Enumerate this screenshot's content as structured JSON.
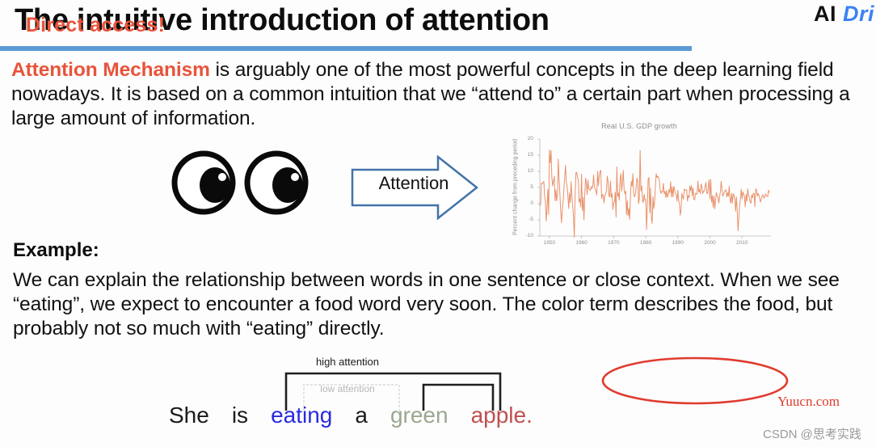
{
  "slide": {
    "title": "The intuitive introduction of attention",
    "logo_prefix": "AI ",
    "logo_accent": "Dri",
    "accent_color": "#5b9bd5",
    "highlight_color": "#e8533a"
  },
  "intro": {
    "highlight": "Attention Mechanism",
    "rest": " is arguably one of the most powerful concepts in the deep learning field nowadays. It is based on a common intuition that we “attend to” a certain part when processing a large amount of information."
  },
  "example": {
    "label": "Example:",
    "text": "We can explain the relationship between words in one sentence or close context. When we see “eating”, we expect to encounter a food word very soon. The color term describes the food, but probably not so much with “eating” directly."
  },
  "arrow": {
    "label": "Attention"
  },
  "eyes": {
    "name": "pair-of-eyes-illustration"
  },
  "callout": {
    "text": "Direct access!",
    "color": "#e8533a"
  },
  "sentence_diagram": {
    "high_attention_label": "high attention",
    "low_attention_label": "low attention",
    "words": [
      {
        "text": "She",
        "color": "#1b1b1b"
      },
      {
        "text": "is",
        "color": "#1b1b1b"
      },
      {
        "text": "eating",
        "color": "#2a2ae0"
      },
      {
        "text": "a",
        "color": "#1b1b1b"
      },
      {
        "text": "green",
        "color": "#9aa890"
      },
      {
        "text": "apple.",
        "color": "#c05050"
      }
    ],
    "footnote": ""
  },
  "watermarks": {
    "yuucn": "Yuucn.com",
    "csdn": "CSDN @思考实践"
  },
  "chart_data": {
    "type": "line",
    "title": "Real U.S. GDP growth",
    "xlabel": "",
    "ylabel": "Percent change from preceding period",
    "xlim": [
      1947,
      2019
    ],
    "ylim": [
      -10,
      20
    ],
    "xticks": [
      1950,
      1960,
      1970,
      1980,
      1990,
      2000,
      2010
    ],
    "yticks": [
      -10,
      -5,
      0,
      5,
      10,
      15,
      20
    ],
    "grid": false,
    "legend": "none",
    "line_color": "#e8926b",
    "x": [
      1947,
      1947.25,
      1947.5,
      1947.75,
      1948,
      1948.25,
      1948.5,
      1948.75,
      1949,
      1949.25,
      1949.5,
      1949.75,
      1950,
      1950.25,
      1950.5,
      1950.75,
      1951,
      1951.25,
      1951.5,
      1951.75,
      1952,
      1952.25,
      1952.5,
      1952.75,
      1953,
      1953.25,
      1953.5,
      1953.75,
      1954,
      1954.25,
      1954.5,
      1954.75,
      1955,
      1955.25,
      1955.5,
      1955.75,
      1956,
      1956.25,
      1956.5,
      1956.75,
      1957,
      1957.25,
      1957.5,
      1957.75,
      1958,
      1958.25,
      1958.5,
      1958.75,
      1959,
      1959.25,
      1959.5,
      1959.75,
      1960,
      1960.25,
      1960.5,
      1960.75,
      1961,
      1961.25,
      1961.5,
      1961.75,
      1962,
      1962.25,
      1962.5,
      1962.75,
      1963,
      1963.25,
      1963.5,
      1963.75,
      1964,
      1964.25,
      1964.5,
      1964.75,
      1965,
      1965.25,
      1965.5,
      1965.75,
      1966,
      1966.25,
      1966.5,
      1966.75,
      1967,
      1967.25,
      1967.5,
      1967.75,
      1968,
      1968.25,
      1968.5,
      1968.75,
      1969,
      1969.25,
      1969.5,
      1969.75,
      1970,
      1970.25,
      1970.5,
      1970.75,
      1971,
      1971.25,
      1971.5,
      1971.75,
      1972,
      1972.25,
      1972.5,
      1972.75,
      1973,
      1973.25,
      1973.5,
      1973.75,
      1974,
      1974.25,
      1974.5,
      1974.75,
      1975,
      1975.25,
      1975.5,
      1975.75,
      1976,
      1976.25,
      1976.5,
      1976.75,
      1977,
      1977.25,
      1977.5,
      1977.75,
      1978,
      1978.25,
      1978.5,
      1978.75,
      1979,
      1979.25,
      1979.5,
      1979.75,
      1980,
      1980.25,
      1980.5,
      1980.75,
      1981,
      1981.25,
      1981.5,
      1981.75,
      1982,
      1982.25,
      1982.5,
      1982.75,
      1983,
      1983.25,
      1983.5,
      1983.75,
      1984,
      1984.25,
      1984.5,
      1984.75,
      1985,
      1985.25,
      1985.5,
      1985.75,
      1986,
      1986.25,
      1986.5,
      1986.75,
      1987,
      1987.25,
      1987.5,
      1987.75,
      1988,
      1988.25,
      1988.5,
      1988.75,
      1989,
      1989.25,
      1989.5,
      1989.75,
      1990,
      1990.25,
      1990.5,
      1990.75,
      1991,
      1991.25,
      1991.5,
      1991.75,
      1992,
      1992.25,
      1992.5,
      1992.75,
      1993,
      1993.25,
      1993.5,
      1993.75,
      1994,
      1994.25,
      1994.5,
      1994.75,
      1995,
      1995.25,
      1995.5,
      1995.75,
      1996,
      1996.25,
      1996.5,
      1996.75,
      1997,
      1997.25,
      1997.5,
      1997.75,
      1998,
      1998.25,
      1998.5,
      1998.75,
      1999,
      1999.25,
      1999.5,
      1999.75,
      2000,
      2000.25,
      2000.5,
      2000.75,
      2001,
      2001.25,
      2001.5,
      2001.75,
      2002,
      2002.25,
      2002.5,
      2002.75,
      2003,
      2003.25,
      2003.5,
      2003.75,
      2004,
      2004.25,
      2004.5,
      2004.75,
      2005,
      2005.25,
      2005.5,
      2005.75,
      2006,
      2006.25,
      2006.5,
      2006.75,
      2007,
      2007.25,
      2007.5,
      2007.75,
      2008,
      2008.25,
      2008.5,
      2008.75,
      2009,
      2009.25,
      2009.5,
      2009.75,
      2010,
      2010.25,
      2010.5,
      2010.75,
      2011,
      2011.25,
      2011.5,
      2011.75,
      2012,
      2012.25,
      2012.5,
      2012.75,
      2013,
      2013.25,
      2013.5,
      2013.75,
      2014,
      2014.25,
      2014.5,
      2014.75,
      2015,
      2015.25,
      2015.5,
      2015.75,
      2016,
      2016.25,
      2016.5,
      2016.75,
      2017,
      2017.25,
      2017.5,
      2017.75,
      2018,
      2018.25,
      2018.5
    ],
    "y": [
      -0.7,
      -0.2,
      6.4,
      6.2,
      6.5,
      6.9,
      2.2,
      0.5,
      -5.4,
      -1.3,
      4.5,
      -3.3,
      16.6,
      12.6,
      16.4,
      7.9,
      5.5,
      7.1,
      8.5,
      0.9,
      4.3,
      0.9,
      2.9,
      13.8,
      7.6,
      3.1,
      -2.2,
      -5.9,
      -1.9,
      0.4,
      4.6,
      8.1,
      11.9,
      6.7,
      5.5,
      2.4,
      -1.5,
      3.3,
      0.4,
      6.8,
      2.5,
      -0.9,
      -4.0,
      -10.4,
      2.6,
      9.6,
      9.7,
      8.0,
      7.4,
      0.5,
      1.5,
      -1.0,
      9.2,
      -2.1,
      2.0,
      -5.0,
      2.6,
      7.9,
      6.7,
      2.8,
      7.3,
      4.7,
      4.5,
      4.1,
      5.3,
      4.7,
      5.4,
      8.8,
      5.2,
      4.5,
      3.9,
      2.7,
      10.0,
      5.6,
      8.6,
      10.0,
      10.3,
      1.6,
      2.8,
      2.7,
      0.2,
      2.6,
      3.0,
      4.0,
      8.5,
      7.1,
      2.6,
      2.1,
      7.0,
      2.0,
      3.1,
      -1.8,
      0.2,
      0.5,
      3.6,
      -4.1,
      11.4,
      2.3,
      3.3,
      1.1,
      7.5,
      9.3,
      3.9,
      6.9,
      10.3,
      4.4,
      3.1,
      3.9,
      -3.4,
      1.0,
      -3.7,
      -1.5,
      -4.8,
      3.0,
      6.9,
      5.4,
      9.3,
      3.1,
      2.1,
      2.9,
      4.8,
      7.9,
      7.1,
      0.0,
      1.4,
      16.5,
      4.0,
      5.5,
      0.7,
      0.4,
      2.9,
      1.1,
      1.3,
      -8.0,
      -0.5,
      7.7,
      8.1,
      -2.9,
      4.9,
      -4.2,
      -6.1,
      2.2,
      -1.5,
      0.3,
      5.3,
      9.3,
      8.1,
      8.5,
      8.0,
      7.1,
      4.0,
      3.2,
      3.9,
      3.6,
      6.3,
      3.1,
      3.8,
      1.9,
      4.1,
      2.0,
      2.7,
      4.4,
      3.4,
      6.8,
      2.1,
      5.2,
      2.1,
      5.4,
      4.1,
      3.2,
      2.7,
      0.9,
      4.2,
      0.9,
      0.0,
      -3.6,
      -1.9,
      3.2,
      2.0,
      1.4,
      4.5,
      4.3,
      4.1,
      4.3,
      0.8,
      2.5,
      2.0,
      5.5,
      4.0,
      5.6,
      2.4,
      4.8,
      1.4,
      1.2,
      3.2,
      3.1,
      2.9,
      7.0,
      3.7,
      4.4,
      3.1,
      6.1,
      5.1,
      3.1,
      3.9,
      3.9,
      5.3,
      6.6,
      3.2,
      3.2,
      5.2,
      7.4,
      1.5,
      7.5,
      0.5,
      2.5,
      -1.1,
      2.4,
      -1.6,
      1.1,
      3.5,
      2.4,
      2.0,
      0.2,
      2.1,
      3.8,
      6.9,
      4.8,
      2.3,
      3.0,
      3.7,
      4.0,
      4.3,
      2.1,
      3.4,
      2.3,
      5.4,
      1.4,
      0.1,
      3.2,
      0.2,
      3.1,
      2.7,
      1.4,
      -2.3,
      2.1,
      -2.1,
      -8.4,
      -4.4,
      -0.6,
      1.5,
      4.5,
      1.5,
      3.7,
      3.0,
      2.0,
      -1.0,
      2.9,
      0.8,
      4.6,
      2.7,
      1.9,
      0.5,
      0.1,
      2.7,
      1.8,
      3.2,
      3.2,
      -0.9,
      4.6,
      4.3,
      2.3,
      3.2,
      2.7,
      1.6,
      0.5,
      1.5,
      2.3,
      2.8,
      1.8,
      1.8,
      3.0,
      2.8,
      2.3,
      2.2,
      4.2,
      3.4
    ]
  }
}
